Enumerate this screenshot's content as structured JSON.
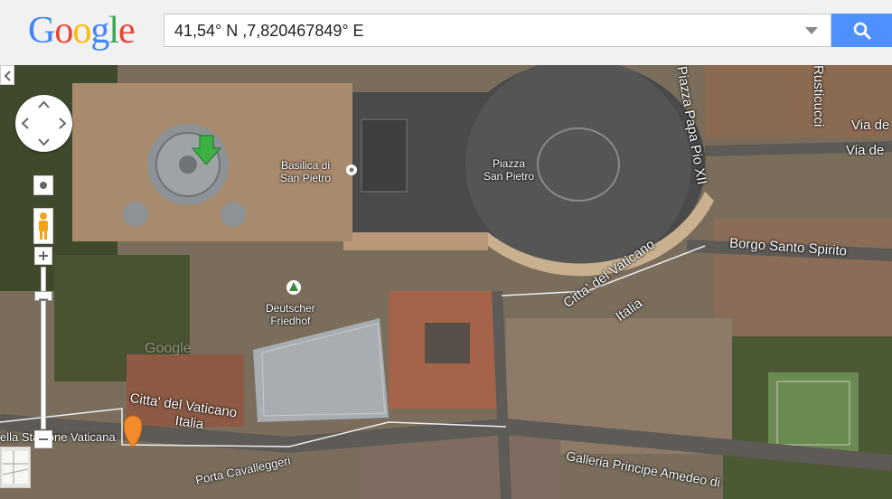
{
  "logo": {
    "letters": [
      "G",
      "o",
      "o",
      "g",
      "l",
      "e"
    ],
    "colors": [
      "#4285f4",
      "#ea4335",
      "#fbbc05",
      "#4285f4",
      "#34a853",
      "#ea4335"
    ]
  },
  "search": {
    "value": "41,54° N ,7,820467849° E"
  },
  "map": {
    "labels": {
      "basilica": "Basilica di\nSan Pietro",
      "piazza": "Piazza\nSan Pietro",
      "friedhof": "Deutscher\nFriedhof",
      "via_rusticucci": "Rusticucci",
      "via_de1": "Via de",
      "via_de2": "Via de",
      "pio_xii": "Piazza Papa Pio XII",
      "borgo": "Borgo Santo Spirito",
      "citta1": "Citta' del Vaticano",
      "italia1": "Italia",
      "citta2": "Citta' del Vaticano",
      "italia2": "Italia",
      "stazione": "ella Stazione Vaticana",
      "galleria": "Galleria Principe Amedeo di",
      "cavalleggeri": "Porta Cavalleggeri",
      "watermark": "Google"
    }
  }
}
